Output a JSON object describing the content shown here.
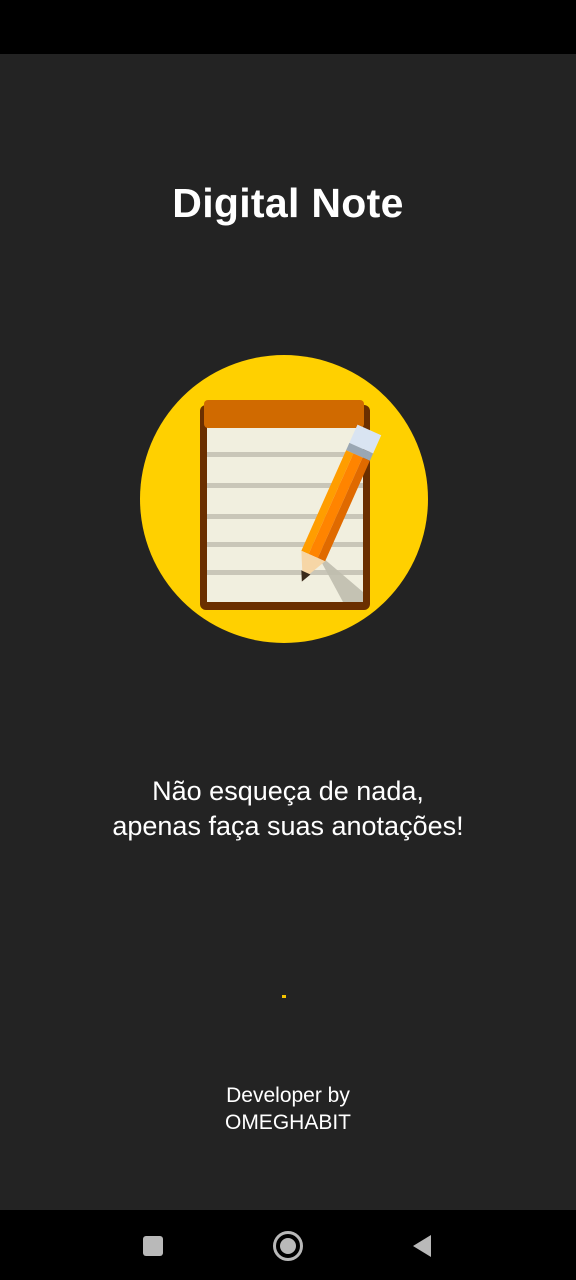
{
  "app": {
    "title": "Digital Note",
    "logo_icon": "notepad-pencil-icon",
    "colors": {
      "background": "#232323",
      "logo_circle": "#ffd000",
      "notepad_top": "#d06a00",
      "pencil": "#ff8c00",
      "loading_indicator": "#f5c400"
    }
  },
  "splash": {
    "tagline_line1": "Não esqueça de nada,",
    "tagline_line2": "apenas faça suas anotações!",
    "developer_line1": "Developer by",
    "developer_line2": "OMEGHABIT"
  },
  "nav_bar": {
    "recents_icon": "square-recents-icon",
    "home_icon": "circle-home-icon",
    "back_icon": "triangle-back-icon"
  }
}
